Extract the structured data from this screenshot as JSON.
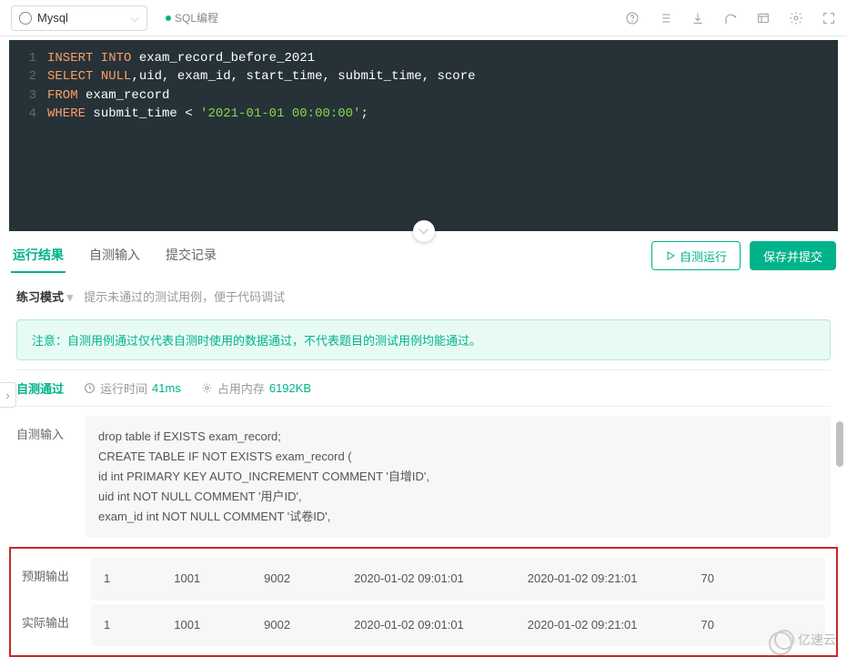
{
  "toolbar": {
    "db_name": "Mysql",
    "tag": "SQL编程"
  },
  "editor": {
    "lines": [
      {
        "n": "1",
        "tokens": [
          {
            "t": "INSERT INTO",
            "c": "k-orange"
          },
          {
            "t": " ",
            "c": "k-white"
          },
          {
            "t": "exam_record_before_2021",
            "c": "k-white"
          }
        ]
      },
      {
        "n": "2",
        "tokens": [
          {
            "t": "SELECT",
            "c": "k-orange"
          },
          {
            "t": " ",
            "c": "k-white"
          },
          {
            "t": "NULL",
            "c": "k-orange"
          },
          {
            "t": ",uid, exam_id, start_time, submit_time, score",
            "c": "k-white"
          }
        ]
      },
      {
        "n": "3",
        "tokens": [
          {
            "t": "FROM",
            "c": "k-orange"
          },
          {
            "t": " exam_record",
            "c": "k-white"
          }
        ]
      },
      {
        "n": "4",
        "tokens": [
          {
            "t": "WHERE",
            "c": "k-orange"
          },
          {
            "t": " submit_time < ",
            "c": "k-white"
          },
          {
            "t": "'2021-01-01 00:00:00'",
            "c": "k-str"
          },
          {
            "t": ";",
            "c": "k-white"
          }
        ]
      }
    ]
  },
  "tabs": {
    "result": "运行结果",
    "input": "自测输入",
    "history": "提交记录"
  },
  "buttons": {
    "selfrun": "自测运行",
    "submit": "保存并提交"
  },
  "submode": {
    "label": "练习模式",
    "hint": "提示未通过的测试用例，便于代码调试"
  },
  "notice": "注意：自测用例通过仅代表自测时使用的数据通过，不代表题目的测试用例均能通过。",
  "status": {
    "pass": "自测通过",
    "time_label": "运行时间",
    "time_value": "41ms",
    "mem_label": "占用内存",
    "mem_value": "6192KB"
  },
  "io": {
    "input_label": "自测输入",
    "input_body": [
      "drop table if EXISTS exam_record;",
      "CREATE TABLE IF NOT EXISTS exam_record (",
      "id int PRIMARY KEY AUTO_INCREMENT COMMENT '自增ID',",
      "uid int NOT NULL COMMENT '用户ID',",
      "exam_id int NOT NULL COMMENT '试卷ID',"
    ],
    "expected_label": "预期输出",
    "actual_label": "实际输出",
    "row": [
      "1",
      "1001",
      "9002",
      "2020-01-02 09:01:01",
      "2020-01-02 09:21:01",
      "70"
    ]
  },
  "watermark": "亿速云"
}
